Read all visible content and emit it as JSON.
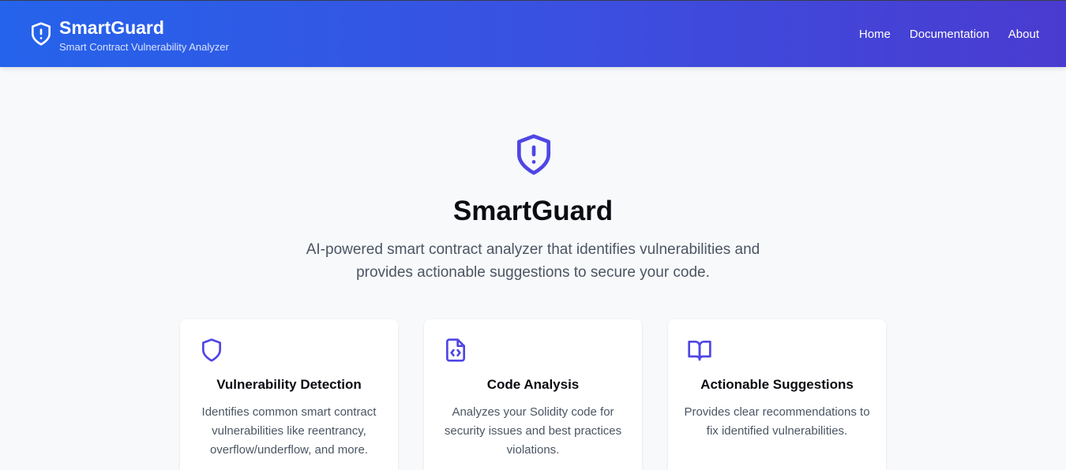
{
  "header": {
    "title": "SmartGuard",
    "subtitle": "Smart Contract Vulnerability Analyzer",
    "nav": [
      "Home",
      "Documentation",
      "About"
    ]
  },
  "hero": {
    "title": "SmartGuard",
    "description": "AI-powered smart contract analyzer that identifies vulnerabilities and provides actionable suggestions to secure your code."
  },
  "features": [
    {
      "icon": "shield-icon",
      "title": "Vulnerability Detection",
      "description": "Identifies common smart contract vulnerabilities like reentrancy, overflow/underflow, and more."
    },
    {
      "icon": "code-file-icon",
      "title": "Code Analysis",
      "description": "Analyzes your Solidity code for security issues and best practices violations."
    },
    {
      "icon": "book-open-icon",
      "title": "Actionable Suggestions",
      "description": "Provides clear recommendations to fix identified vulnerabilities."
    }
  ],
  "colors": {
    "header_gradient_start": "#2563eb",
    "header_gradient_end": "#4a3bd0",
    "accent": "#4f46e5",
    "background": "#f8f9fb"
  }
}
